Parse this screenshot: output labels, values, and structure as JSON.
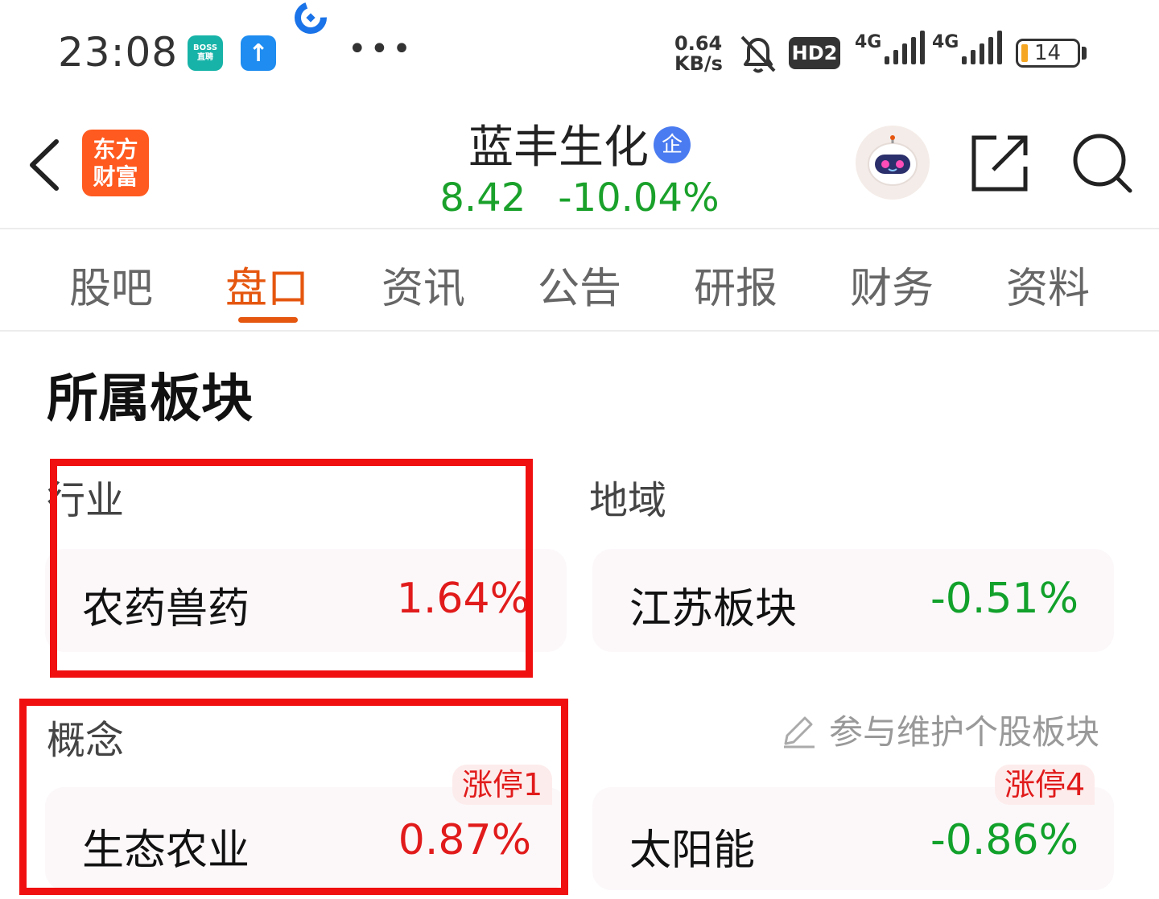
{
  "status_bar": {
    "time": "23:08",
    "boss_line1": "BOSS",
    "boss_line2": "直聘",
    "net_speed_value": "0.64",
    "net_speed_unit": "KB/s",
    "hd_label": "HD2",
    "signal1_label": "4G",
    "signal2_label": "4G",
    "battery_level": "14",
    "icons": [
      "boss-zhipin-app-icon",
      "upload-app-icon",
      "cmb-bank-app-icon",
      "more-dots-icon",
      "bell-muted-icon",
      "signal-icon",
      "battery-icon"
    ]
  },
  "header": {
    "logo_line1": "东方",
    "logo_line2": "财富",
    "stock_name": "蓝丰生化",
    "badge": "企",
    "price": "8.42",
    "change_pct": "-10.04%"
  },
  "tabs": [
    {
      "label": "股吧",
      "active": false
    },
    {
      "label": "盘口",
      "active": true
    },
    {
      "label": "资讯",
      "active": false
    },
    {
      "label": "公告",
      "active": false
    },
    {
      "label": "研报",
      "active": false
    },
    {
      "label": "财务",
      "active": false
    },
    {
      "label": "资料",
      "active": false
    }
  ],
  "sectors": {
    "title": "所属板块",
    "industry_label": "行业",
    "region_label": "地域",
    "concept_label": "概念",
    "edit_link": "参与维护个股板块",
    "industry": {
      "name": "农药兽药",
      "change": "1.64%"
    },
    "region": {
      "name": "江苏板块",
      "change": "-0.51%"
    },
    "concepts": [
      {
        "name": "生态农业",
        "change": "0.87%",
        "tag": "涨停1"
      },
      {
        "name": "太阳能",
        "change": "-0.86%",
        "tag": "涨停4"
      }
    ]
  },
  "colors": {
    "accent": "#e5560f",
    "up_red": "#e11b1b",
    "down_green": "#12a12b",
    "highlight_box": "#f01010"
  }
}
